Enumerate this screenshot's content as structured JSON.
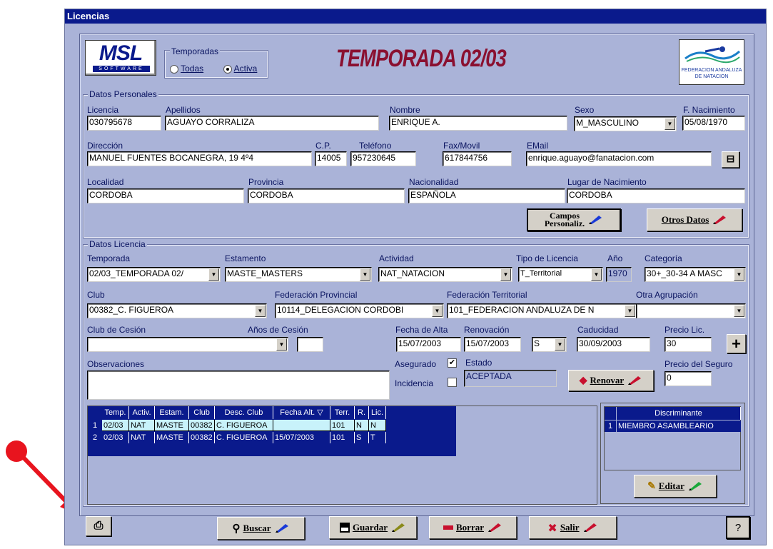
{
  "window": {
    "title": "Licencias"
  },
  "header": {
    "logo_text": "MSL",
    "logo_sub": "SOFTWARE",
    "temporadas_label": "Temporadas",
    "radio_todas": "Todas",
    "radio_activa": "Activa",
    "selected": "Activa",
    "banner": "TEMPORADA 02/03",
    "fed_logo_line1": "FEDERACION ANDALUZA",
    "fed_logo_line2": "DE NATACION"
  },
  "personal": {
    "legend": "Datos Personales",
    "labels": {
      "licencia": "Licencia",
      "apellidos": "Apellidos",
      "nombre": "Nombre",
      "sexo": "Sexo",
      "fnac": "F. Nacimiento",
      "direccion": "Dirección",
      "cp": "C.P.",
      "telefono": "Teléfono",
      "fax": "Fax/Movil",
      "email": "EMail",
      "localidad": "Localidad",
      "provincia": "Provincia",
      "nacionalidad": "Nacionalidad",
      "lugar": "Lugar de Nacimiento"
    },
    "values": {
      "licencia": "030795678",
      "apellidos": "AGUAYO CORRALIZA",
      "nombre": "ENRIQUE A.",
      "sexo": "M_MASCULINO",
      "fnac": "05/08/1970",
      "direccion": "MANUEL FUENTES BOCANEGRA, 19 4º4",
      "cp": "14005",
      "telefono": "957230645",
      "fax": "617844756",
      "email": "enrique.aguayo@fanatacion.com",
      "localidad": "CORDOBA",
      "provincia": "CORDOBA",
      "nacionalidad": "ESPAÑOLA",
      "lugar": "CORDOBA"
    },
    "btn_campos_1": "Campos",
    "btn_campos_2": "Personaliz.",
    "btn_otros": "Otros Datos"
  },
  "licencia": {
    "legend": "Datos Licencia",
    "labels": {
      "temporada": "Temporada",
      "estamento": "Estamento",
      "actividad": "Actividad",
      "tipo": "Tipo de Licencia",
      "anio": "Año",
      "categoria": "Categoría",
      "club": "Club",
      "fedprov": "Federación Provincial",
      "fedterr": "Federación Territorial",
      "otra": "Otra Agrupación",
      "cesion": "Club de Cesión",
      "anios_cesion": "Años de Cesión",
      "fecha_alta": "Fecha de Alta",
      "renovacion": "Renovación",
      "caducidad": "Caducidad",
      "precio": "Precio Lic.",
      "observaciones": "Observaciones",
      "asegurado": "Asegurado",
      "estado": "Estado",
      "incidencia": "Incidencia",
      "precio_seguro": "Precio del Seguro"
    },
    "values": {
      "temporada": "02/03_TEMPORADA 02/",
      "estamento": "MASTE_MASTERS",
      "actividad": "NAT_NATACION",
      "tipo": "T_Territorial",
      "anio": "1970",
      "categoria": "30+_30-34 A MASC",
      "club": "00382_C. FIGUEROA",
      "fedprov": "10114_DELEGACION CORDOBI",
      "fedterr": "101_FEDERACION ANDALUZA DE N",
      "otra": "",
      "cesion": "",
      "anios_cesion": "",
      "fecha_alta": "15/07/2003",
      "renovacion": "15/07/2003",
      "renov_flag": "S",
      "caducidad": "30/09/2003",
      "precio": "30",
      "observaciones": "",
      "asegurado": "✔",
      "incidencia": "",
      "estado": "ACEPTADA",
      "precio_seguro": "0"
    },
    "btn_renovar": "Renovar",
    "btn_plus": "+"
  },
  "grid": {
    "headers": [
      "Temp.",
      "Activ.",
      "Estam.",
      "Club",
      "Desc. Club",
      "Fecha Alt. ▽",
      "Terr.",
      "R.",
      "Lic."
    ],
    "rows": [
      {
        "n": "1",
        "cells": [
          "02/03",
          "NAT",
          "MASTE",
          "00382",
          "C. FIGUEROA",
          "",
          "101",
          "N",
          "N"
        ]
      },
      {
        "n": "2",
        "cells": [
          "02/03",
          "NAT",
          "MASTE",
          "00382",
          "C. FIGUEROA",
          "15/07/2003",
          "101",
          "S",
          "T"
        ]
      }
    ]
  },
  "disc": {
    "header": "Discriminante",
    "rows": [
      {
        "n": "1",
        "value": "MIEMBRO ASAMBLEARIO"
      }
    ],
    "btn_editar": "Editar"
  },
  "toolbar": {
    "print": "⎙",
    "buscar": "Buscar",
    "guardar": "Guardar",
    "borrar": "Borrar",
    "salir": "Salir",
    "help": "?"
  },
  "colors": {
    "accent": "#0a1a8c",
    "window": "#aab3d8",
    "banner": "#8a1030",
    "arrow": "#e8141e"
  }
}
